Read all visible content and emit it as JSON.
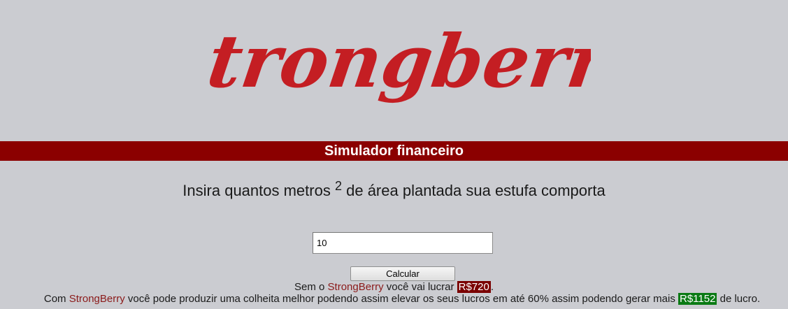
{
  "logo": {
    "text": "Strongberry",
    "color": "#c41e23"
  },
  "banner": {
    "title": "Simulador financeiro",
    "color": "#8b0000"
  },
  "prompt": {
    "before": "Insira quantos metros",
    "superscript": "2",
    "after": "de área plantada sua estufa comporta"
  },
  "area_input": {
    "value": "10"
  },
  "calc_button": {
    "label": "Calcular"
  },
  "result_without": {
    "prefix": "Sem o ",
    "brand": "StrongBerry",
    "middle": " você vai lucrar ",
    "amount": "R$720",
    "suffix": "."
  },
  "result_with": {
    "prefix": "Com ",
    "brand": "StrongBerry",
    "middle": " você pode produzir uma colheita melhor podendo assim elevar os seus lucros em até 60% assim podendo gerar mais ",
    "amount": "R$1152",
    "suffix": " de lucro."
  },
  "colors": {
    "background": "#cbccd1",
    "brand_text": "#8b1a1a",
    "badge_red": "#7a0000",
    "badge_green": "#0a7a14"
  }
}
